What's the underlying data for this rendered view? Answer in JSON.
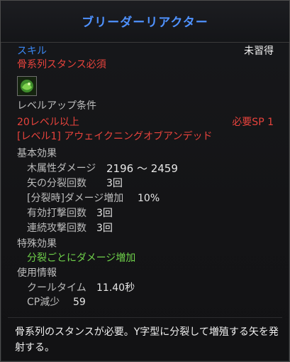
{
  "tooltip": {
    "title": "ブリーダーリアクター",
    "category": "スキル",
    "status": "未習得",
    "requirement": "骨系列スタンス必須",
    "level_section_label": "レベルアップ条件",
    "level_required": "20レベル以上",
    "sp_required": "必要SP 1",
    "prerequisite": "[レベル1] アウェイクニングオブアンデッド",
    "basic_effects_label": "基本効果",
    "effects": [
      {
        "label": "木属性ダメージ",
        "value": "2196 ～ 2459"
      },
      {
        "label": "矢の分裂回数",
        "value": "3回"
      },
      {
        "label": "[分裂時]ダメージ増加",
        "value": "10%"
      },
      {
        "label": "有効打撃回数",
        "value": "3回"
      },
      {
        "label": "連続攻撃回数",
        "value": "3回"
      }
    ],
    "special_effects_label": "特殊効果",
    "special_effect": "分裂ごとにダメージ増加",
    "usage_label": "使用情報",
    "usage": [
      {
        "label": "クールタイム",
        "value": "11.40秒"
      },
      {
        "label": "CP減少",
        "value": "59"
      }
    ],
    "description": "骨系列のスタンスが必要。Y字型に分裂して増殖する矢を発射する。",
    "icon": "green-skill-icon"
  },
  "colors": {
    "title": "#4f92ff",
    "category": "#3b88f4",
    "warning": "#e8433c",
    "special": "#6fd14a"
  }
}
